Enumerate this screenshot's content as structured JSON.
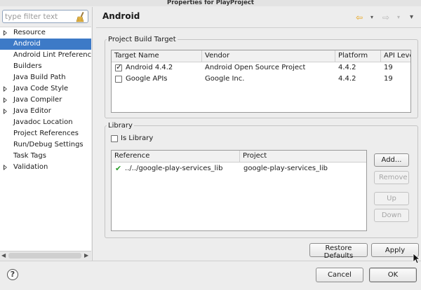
{
  "window": {
    "title": "Properties for PlayProject"
  },
  "filter": {
    "placeholder": "type filter text",
    "value": ""
  },
  "tree": [
    {
      "label": "Resource",
      "expandable": true,
      "selected": false
    },
    {
      "label": "Android",
      "expandable": false,
      "selected": true
    },
    {
      "label": "Android Lint Preferences",
      "expandable": false,
      "selected": false
    },
    {
      "label": "Builders",
      "expandable": false,
      "selected": false
    },
    {
      "label": "Java Build Path",
      "expandable": false,
      "selected": false
    },
    {
      "label": "Java Code Style",
      "expandable": true,
      "selected": false
    },
    {
      "label": "Java Compiler",
      "expandable": true,
      "selected": false
    },
    {
      "label": "Java Editor",
      "expandable": true,
      "selected": false
    },
    {
      "label": "Javadoc Location",
      "expandable": false,
      "selected": false
    },
    {
      "label": "Project References",
      "expandable": false,
      "selected": false
    },
    {
      "label": "Run/Debug Settings",
      "expandable": false,
      "selected": false
    },
    {
      "label": "Task Tags",
      "expandable": false,
      "selected": false
    },
    {
      "label": "Validation",
      "expandable": true,
      "selected": false
    }
  ],
  "page": {
    "title": "Android"
  },
  "build_target": {
    "legend": "Project Build Target",
    "columns": [
      "Target Name",
      "Vendor",
      "Platform",
      "API Level"
    ],
    "rows": [
      {
        "checked": true,
        "name": "Android 4.4.2",
        "vendor": "Android Open Source Project",
        "platform": "4.4.2",
        "api": "19"
      },
      {
        "checked": false,
        "name": "Google APIs",
        "vendor": "Google Inc.",
        "platform": "4.4.2",
        "api": "19"
      }
    ]
  },
  "library": {
    "legend": "Library",
    "is_library_label": "Is Library",
    "is_library_checked": false,
    "columns": [
      "Reference",
      "Project"
    ],
    "rows": [
      {
        "status": "ok",
        "reference": "../../google-play-services_lib",
        "project": "google-play-services_lib"
      }
    ],
    "buttons": {
      "add": "Add...",
      "remove": "Remove",
      "up": "Up",
      "down": "Down"
    }
  },
  "actions": {
    "restore_defaults": "Restore Defaults",
    "apply": "Apply",
    "cancel": "Cancel",
    "ok": "OK"
  },
  "icons": {
    "help": "?",
    "back": "⇦",
    "forward": "⇨",
    "menu": "▾",
    "ok": "✔"
  },
  "colors": {
    "selection": "#3d7ac7",
    "back_arrow": "#e8a317",
    "ok_check": "#2a9d2a"
  }
}
